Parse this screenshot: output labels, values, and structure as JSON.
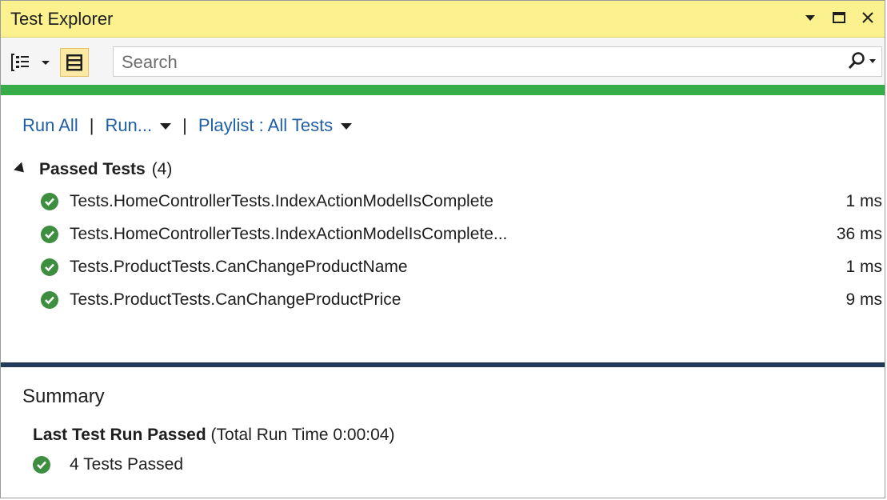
{
  "window": {
    "title": "Test Explorer"
  },
  "toolbar": {
    "search_placeholder": "Search"
  },
  "progress_color": "#36ad48",
  "commands": {
    "run_all": "Run All",
    "run": "Run...",
    "playlist": "Playlist : All Tests"
  },
  "group": {
    "name": "Passed Tests",
    "count": "(4)"
  },
  "tests": [
    {
      "name": "Tests.HomeControllerTests.IndexActionModelIsComplete",
      "time": "1 ms"
    },
    {
      "name": "Tests.HomeControllerTests.IndexActionModelIsComplete...",
      "time": "36 ms"
    },
    {
      "name": "Tests.ProductTests.CanChangeProductName",
      "time": "1 ms"
    },
    {
      "name": "Tests.ProductTests.CanChangeProductPrice",
      "time": "9 ms"
    }
  ],
  "summary": {
    "title": "Summary",
    "status": "Last Test Run Passed",
    "runtime": "(Total Run Time 0:00:04)",
    "result": "4 Tests Passed"
  }
}
